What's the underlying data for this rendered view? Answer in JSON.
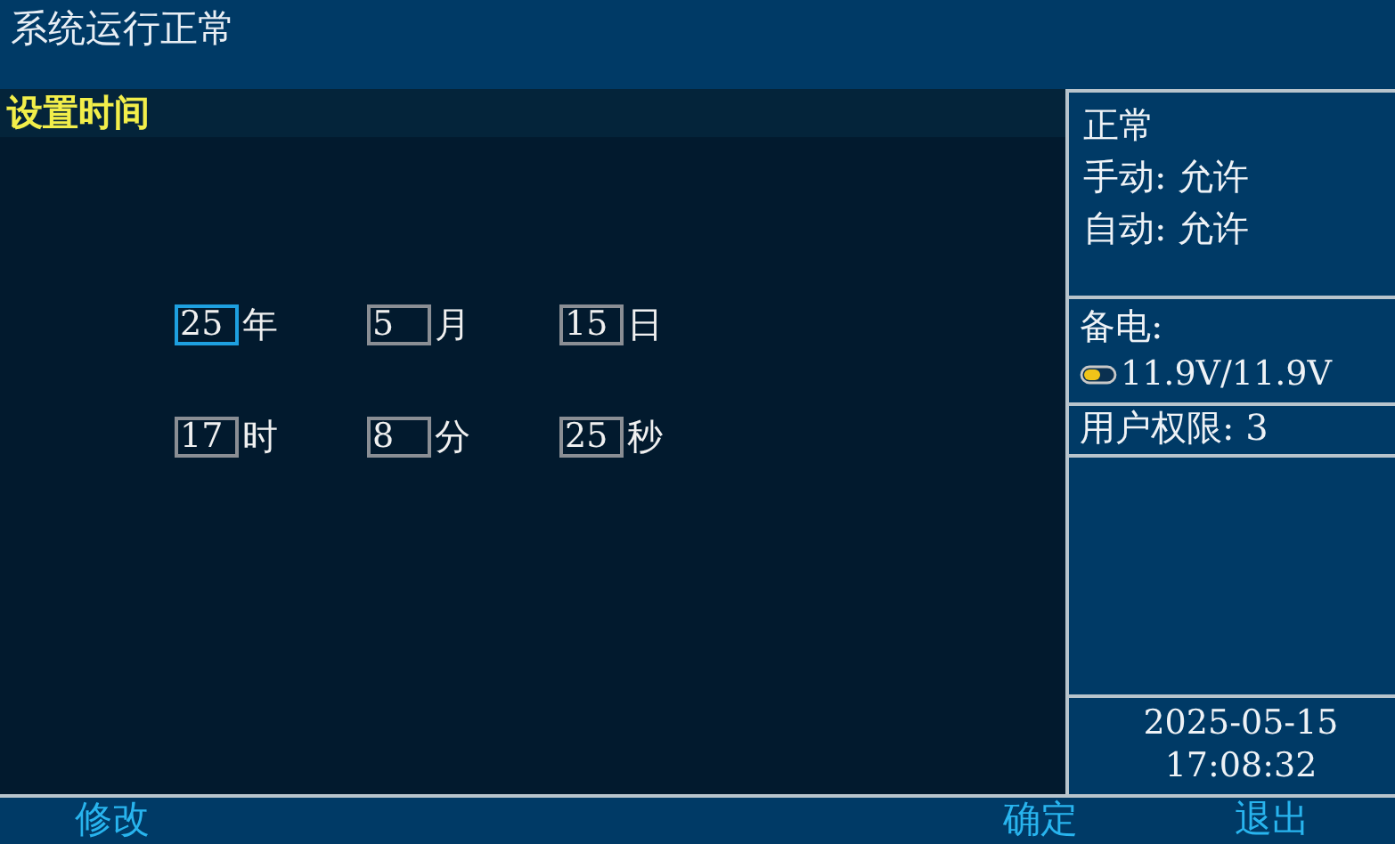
{
  "status_bar": {
    "text": "系统运行正常"
  },
  "panel": {
    "title": "设置时间",
    "fields": [
      {
        "value": "25",
        "unit": "年",
        "selected": true
      },
      {
        "value": "5",
        "unit": "月",
        "selected": false
      },
      {
        "value": "15",
        "unit": "日",
        "selected": false
      },
      {
        "value": "17",
        "unit": "时",
        "selected": false
      },
      {
        "value": "8",
        "unit": "分",
        "selected": false
      },
      {
        "value": "25",
        "unit": "秒",
        "selected": false
      }
    ]
  },
  "sidebar": {
    "state": "正常",
    "lines": [
      "手动: 允许",
      "自动: 允许"
    ],
    "backup_label": "备电:",
    "backup_voltage": "11.9V/11.9V",
    "permission": "用户权限: 3",
    "date": "2025-05-15",
    "time": "17:08:32"
  },
  "softkeys": [
    {
      "label": "修改"
    },
    {
      "label": "确定"
    },
    {
      "label": "退出"
    }
  ]
}
